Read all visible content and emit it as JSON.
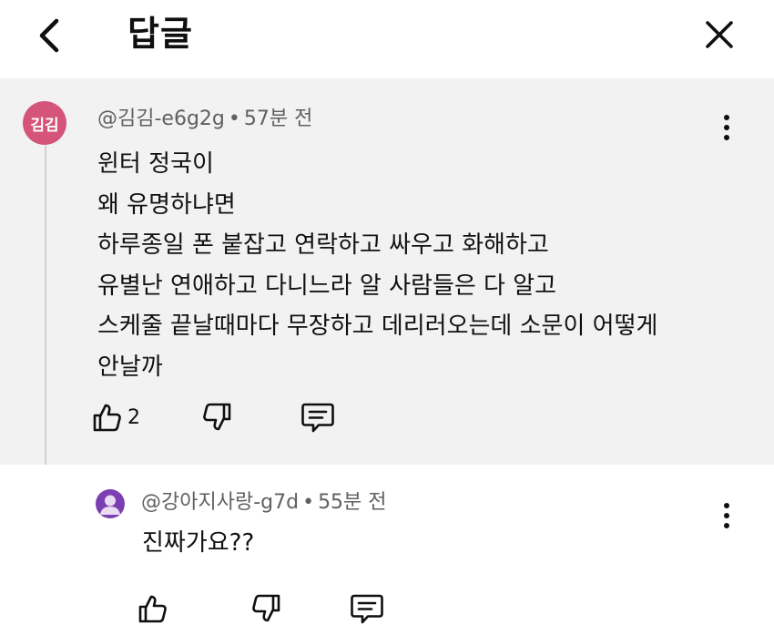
{
  "header": {
    "title": "답글",
    "back_icon": "chevron-left-icon",
    "close_icon": "close-icon"
  },
  "parent_comment": {
    "avatar_text": "김김",
    "avatar_color": "#d5547a",
    "author": "@김김-e6g2g",
    "time": "57분 전",
    "lines": [
      "윈터 정국이",
      "왜 유명하냐면",
      "하루종일 폰 붙잡고 연락하고 싸우고 화해하고",
      "유별난 연애하고 다니느라 알 사람들은 다 알고",
      "스케줄 끝날때마다 무장하고 데리러오는데 소문이 어떻게",
      "안날까"
    ],
    "like_count": "2",
    "background": "#f2f2f2"
  },
  "reply_comment": {
    "avatar_color": "#7b3fb1",
    "author": "@강아지사랑-g7d",
    "time": "55분 전",
    "text": "진짜가요??"
  },
  "separator": "•"
}
